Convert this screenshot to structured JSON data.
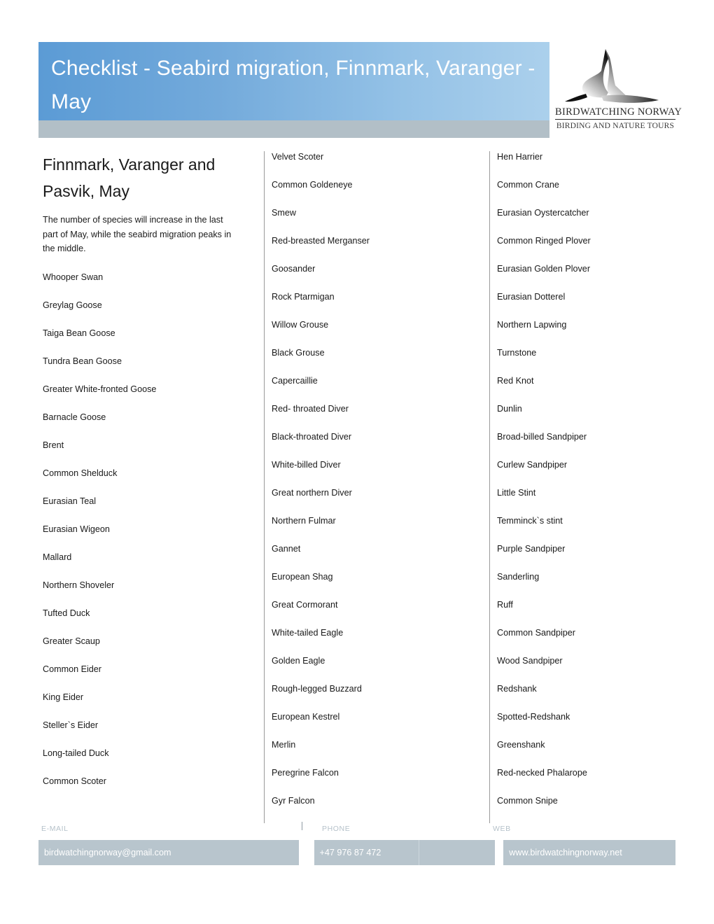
{
  "header": {
    "title": "Checklist  - Seabird migration, Finnmark, Varanger - May",
    "accent_color": "#5b9bd5",
    "grey_bar_color": "#b2bfc7"
  },
  "logo": {
    "icon": "flying-gull-silhouette",
    "name_line1": "BIRDWATCHING NORWAY",
    "name_line2": "BIRDING AND NATURE TOURS"
  },
  "content": {
    "column_title": "Finnmark, Varanger and Pasvik, May",
    "intro": "The number of species will increase in the last part of May, while the seabird migration peaks in the middle.",
    "columns": [
      {
        "species": [
          "Whooper Swan",
          "Greylag Goose",
          "Taiga Bean Goose",
          "Tundra Bean Goose",
          "Greater White-fronted Goose",
          "Barnacle Goose",
          "Brent",
          "Common Shelduck",
          "Eurasian Teal",
          "Eurasian Wigeon",
          "Mallard",
          "Northern Shoveler",
          "Tufted Duck",
          "Greater Scaup",
          "Common Eider",
          "King Eider",
          "Steller`s Eider",
          "Long-tailed Duck",
          "Common Scoter"
        ]
      },
      {
        "species": [
          "Velvet Scoter",
          "Common Goldeneye",
          "Smew",
          "Red-breasted Merganser",
          "Goosander",
          "Rock Ptarmigan",
          "Willow Grouse",
          "Black Grouse",
          "Capercaillie",
          "Red- throated Diver",
          "Black-throated Diver",
          "White-billed Diver",
          "Great northern Diver",
          "Northern Fulmar",
          "Gannet",
          "European Shag",
          "Great Cormorant",
          "White-tailed Eagle",
          "Golden Eagle",
          "Rough-legged Buzzard",
          "European Kestrel",
          "Merlin",
          "Peregrine Falcon",
          "Gyr Falcon"
        ]
      },
      {
        "species": [
          "Hen Harrier",
          "Common Crane",
          "Eurasian Oystercatcher",
          "Common Ringed Plover",
          "Eurasian Golden Plover",
          "Eurasian Dotterel",
          "Northern Lapwing",
          "Turnstone",
          "Red Knot",
          "Dunlin",
          "Broad-billed Sandpiper",
          "Curlew Sandpiper",
          "Little Stint",
          "Temminck`s stint",
          "Purple Sandpiper",
          "Sanderling",
          "Ruff",
          "Common Sandpiper",
          "Wood Sandpiper",
          "Redshank",
          "Spotted-Redshank",
          "Greenshank",
          "Red-necked Phalarope",
          "Common Snipe"
        ]
      }
    ]
  },
  "footer": {
    "email_label": "E-MAIL",
    "phone_label": "PHONE",
    "web_label": "WEB",
    "email_value": "birdwatchingnorway@gmail.com",
    "phone_value": "+47 976 87 472",
    "web_value": "www.birdwatchingnorway.net",
    "band_color": "#b8c5cd"
  }
}
